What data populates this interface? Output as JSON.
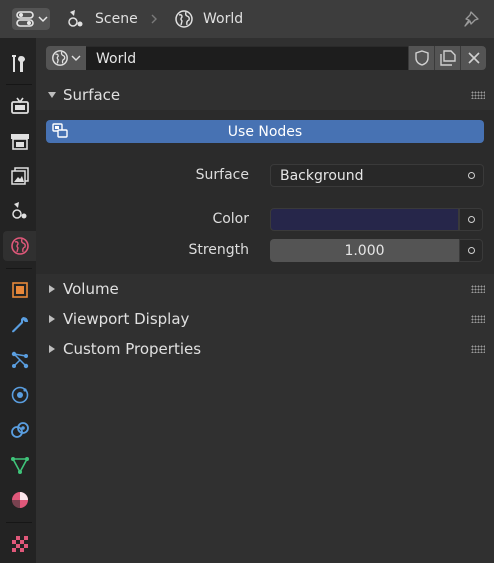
{
  "header": {
    "breadcrumb": [
      {
        "label": "Scene",
        "icon": "scene-icon"
      },
      {
        "label": "World",
        "icon": "world-icon"
      }
    ],
    "pin_icon": "pin-icon",
    "editor_type_icon": "properties-editor-icon"
  },
  "sidebar": {
    "tabs": [
      {
        "name": "tool",
        "icon": "tool-icon",
        "active": false
      },
      {
        "name": "render",
        "icon": "render-icon",
        "active": false
      },
      {
        "name": "output",
        "icon": "output-icon",
        "active": false
      },
      {
        "name": "view-layer",
        "icon": "view-layer-icon",
        "active": false
      },
      {
        "name": "scene",
        "icon": "scene-icon",
        "active": false
      },
      {
        "name": "world",
        "icon": "world-icon",
        "active": true
      },
      {
        "name": "object",
        "icon": "object-icon",
        "active": false
      },
      {
        "name": "modifiers",
        "icon": "wrench-icon",
        "active": false
      },
      {
        "name": "particles",
        "icon": "particles-icon",
        "active": false
      },
      {
        "name": "physics",
        "icon": "physics-icon",
        "active": false
      },
      {
        "name": "constraints",
        "icon": "constraints-icon",
        "active": false
      },
      {
        "name": "data",
        "icon": "mesh-data-icon",
        "active": false
      },
      {
        "name": "material",
        "icon": "material-icon",
        "active": false
      },
      {
        "name": "texture",
        "icon": "texture-icon",
        "active": false
      }
    ]
  },
  "datablock": {
    "name": "World"
  },
  "panels": {
    "surface": {
      "title": "Surface",
      "use_nodes_label": "Use Nodes",
      "surface_label": "Surface",
      "surface_value": "Background",
      "color_label": "Color",
      "color_value": "#26264a",
      "strength_label": "Strength",
      "strength_value": "1.000"
    },
    "volume": {
      "title": "Volume"
    },
    "viewport_display": {
      "title": "Viewport Display"
    },
    "custom_properties": {
      "title": "Custom Properties"
    }
  },
  "colors": {
    "accent": "#4772b3",
    "world_tab_active": "#303030"
  }
}
